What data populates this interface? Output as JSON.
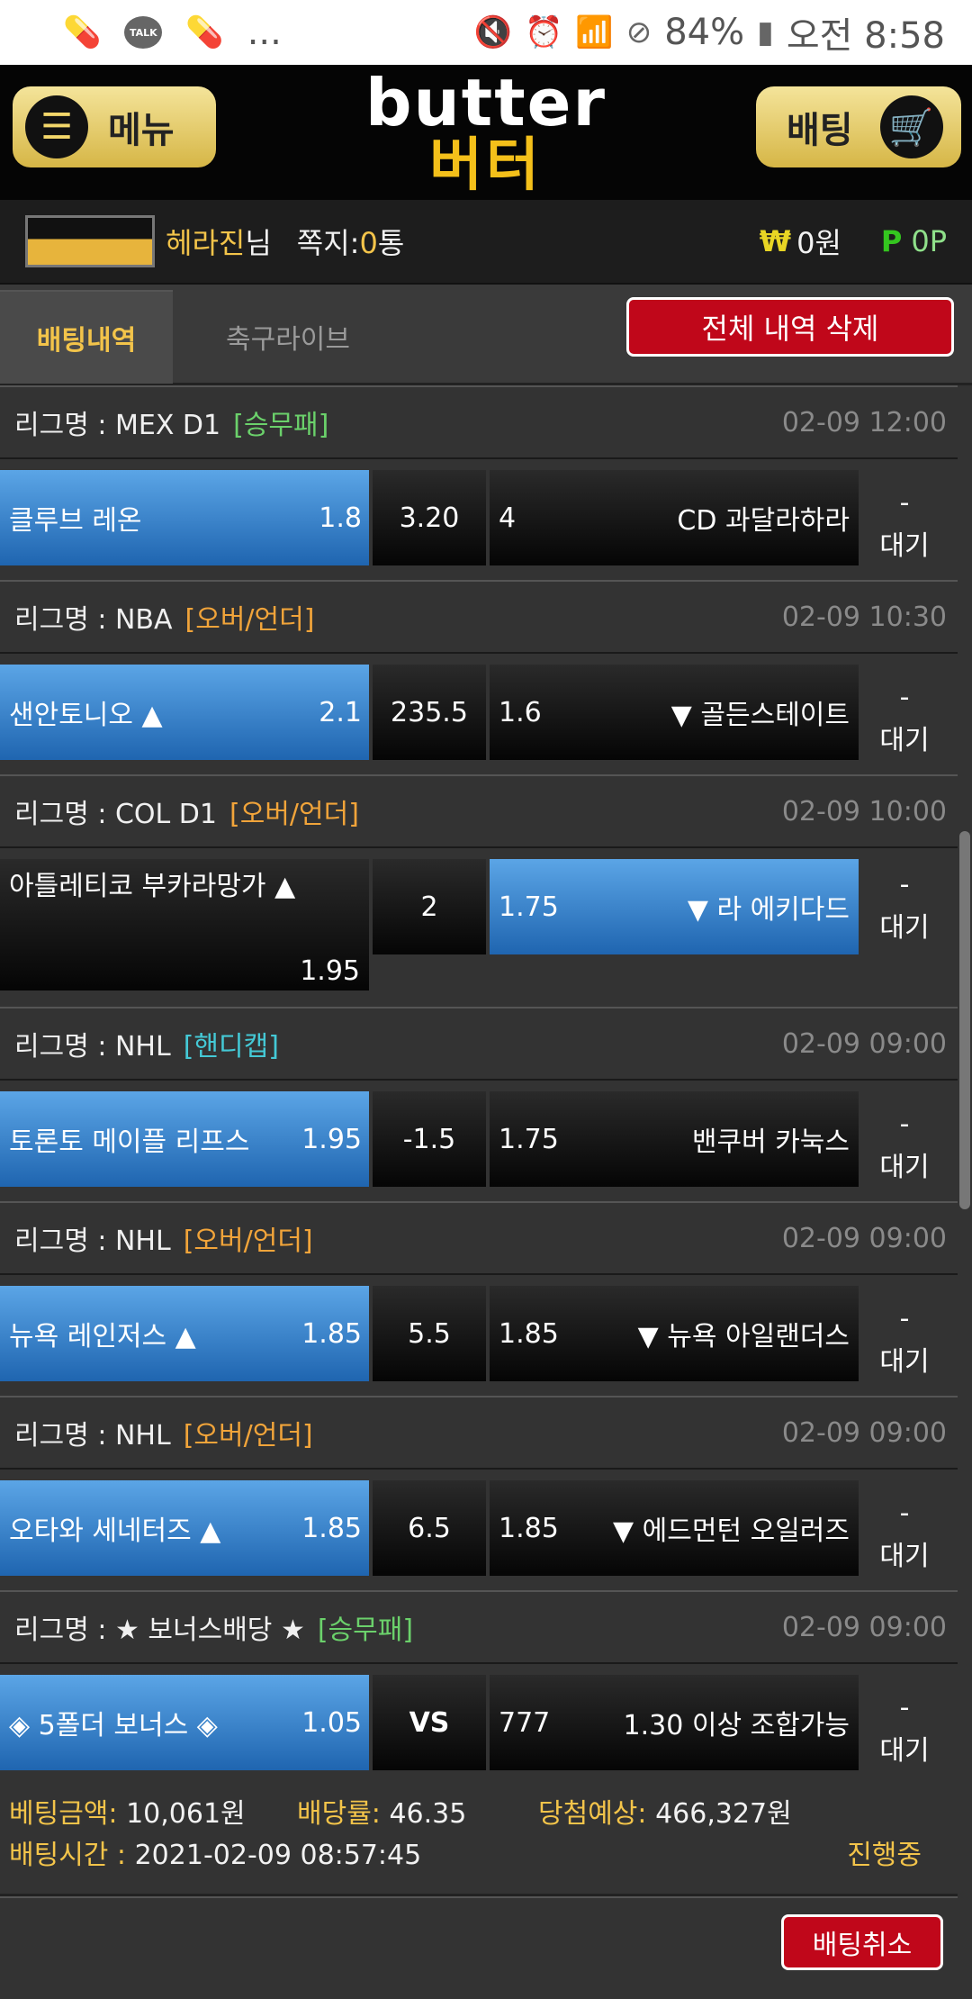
{
  "status_bar": {
    "battery": "84%",
    "time": "오전 8:58",
    "ellipsis": "...",
    "talk": "TALK"
  },
  "header": {
    "menu_label": "메뉴",
    "bet_label": "배팅",
    "logo_en": "butter",
    "logo_ko": "버터"
  },
  "user": {
    "name": "헤라진",
    "suffix": "님",
    "msg_label": "쪽지:",
    "msg_count": "0",
    "msg_unit": "통",
    "won_symbol": "₩",
    "money": "0원",
    "point_symbol": "P",
    "points": "0P"
  },
  "tabs": {
    "active": "배팅내역",
    "live": "축구라이브",
    "delete_all": "전체 내역 삭제"
  },
  "games": [
    {
      "league_label": "리그명 : MEX D1",
      "type": "[승무패]",
      "date": "02-09 12:00",
      "home": "클루브 레온",
      "home_odds": "1.8",
      "mid": "3.20",
      "away_odds": "4",
      "away": "CD 과달라하라",
      "result": "-",
      "status": "대기"
    },
    {
      "league_label": "리그명 : NBA",
      "type": "[오버/언더]",
      "date": "02-09 10:30",
      "home": "샌안토니오 ▲",
      "home_odds": "2.1",
      "mid": "235.5",
      "away_odds": "1.6",
      "away": "▼ 골든스테이트",
      "result": "-",
      "status": "대기"
    },
    {
      "league_label": "리그명 : COL D1",
      "type": "[오버/언더]",
      "date": "02-09 10:00",
      "home": "아틀레티코 부카라망가 ▲",
      "home_odds": "1.95",
      "mid": "2",
      "away_odds": "1.75",
      "away": "▼ 라 에키다드",
      "result": "-",
      "status": "대기"
    },
    {
      "league_label": "리그명 : NHL",
      "type": "[핸디캡]",
      "date": "02-09 09:00",
      "home": "토론토 메이플 리프스",
      "home_odds": "1.95",
      "mid": "-1.5",
      "away_odds": "1.75",
      "away": "밴쿠버 카눅스",
      "result": "-",
      "status": "대기"
    },
    {
      "league_label": "리그명 : NHL",
      "type": "[오버/언더]",
      "date": "02-09 09:00",
      "home": "뉴욕 레인저스 ▲",
      "home_odds": "1.85",
      "mid": "5.5",
      "away_odds": "1.85",
      "away": "▼ 뉴욕 아일랜더스",
      "result": "-",
      "status": "대기"
    },
    {
      "league_label": "리그명 : NHL",
      "type": "[오버/언더]",
      "date": "02-09 09:00",
      "home": "오타와 세네터즈 ▲",
      "home_odds": "1.85",
      "mid": "6.5",
      "away_odds": "1.85",
      "away": "▼ 에드먼턴 오일러즈",
      "result": "-",
      "status": "대기"
    },
    {
      "league_label": "리그명 : ★ 보너스배당 ★",
      "type": "[승무패]",
      "date": "02-09 09:00",
      "home": "◈ 5폴더 보너스 ◈",
      "home_odds": "1.05",
      "mid": "VS",
      "away_odds": "777",
      "away": "1.30 이상 조합가능",
      "result": "-",
      "status": "대기"
    }
  ],
  "summary": {
    "amount_label": "베팅금액:",
    "amount": "10,061원",
    "rate_label": "배당률:",
    "rate": "46.35",
    "expected_label": "당첨예상:",
    "expected": "466,327원",
    "time_label": "배팅시간 :",
    "time": "2021-02-09 08:57:45",
    "progress": "진행중",
    "cancel": "배팅취소"
  }
}
